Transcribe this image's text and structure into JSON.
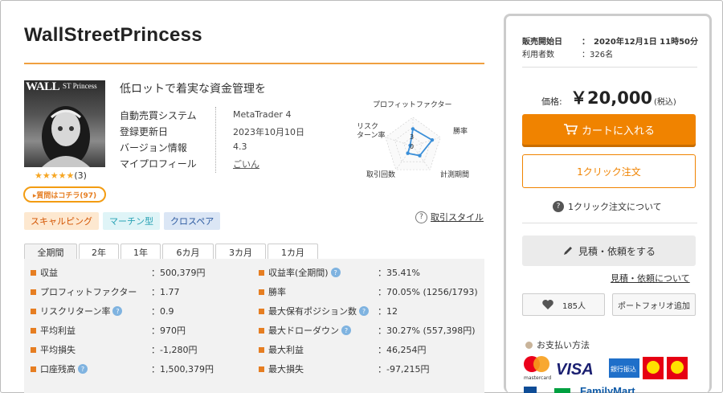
{
  "product": {
    "title": "WallStreetPrincess",
    "tagline": "低ロットで着実な資金管理を",
    "image_logo": "WALL",
    "image_logo_sub": "ST Princess",
    "stars": "★★★★★",
    "review_count": "(3)",
    "question_badge": "▸質問はコチラ(97)",
    "specs": [
      {
        "label": "自動売買システム",
        "value": "MetaTrader 4"
      },
      {
        "label": "登録更新日",
        "value": "2023年10月10日"
      },
      {
        "label": "バージョン情報",
        "value": "4.3"
      },
      {
        "label": "マイプロフィール",
        "value": "ごいん"
      }
    ],
    "tags": [
      "スキャルピング",
      "マーチン型",
      "クロスペア"
    ],
    "help_link": "取引スタイル"
  },
  "radar": {
    "axes": [
      "プロフィットファクター",
      "勝率",
      "計測期間",
      "取引回数",
      "リスク\nターン率"
    ],
    "axis_label_lines": [
      [
        "プロフィットファクター"
      ],
      [
        "勝率"
      ],
      [
        "計測期間"
      ],
      [
        "取引回数"
      ],
      [
        "リスク",
        "ターン率"
      ]
    ],
    "scale_labels": [
      "3",
      "0"
    ],
    "values": [
      3,
      3.5,
      2,
      1.5,
      0.5
    ],
    "max": 5,
    "color": "#3a8fd9"
  },
  "period_tabs": [
    "全期間",
    "2年",
    "1年",
    "6カ月",
    "3カ月",
    "1カ月"
  ],
  "stats_left": [
    {
      "label": "収益",
      "value": "：500,379円",
      "help": false
    },
    {
      "label": "プロフィットファクター",
      "value": "：1.77",
      "help": false
    },
    {
      "label": "リスクリターン率",
      "value": "：0.9",
      "help": true
    },
    {
      "label": "平均利益",
      "value": "：970円",
      "help": false
    },
    {
      "label": "平均損失",
      "value": "：-1,280円",
      "help": false
    },
    {
      "label": "口座残高",
      "value": "：1,500,379円",
      "help": true
    }
  ],
  "stats_right": [
    {
      "label": "収益率(全期間)",
      "value": "：35.41%",
      "help": true
    },
    {
      "label": "勝率",
      "value": "：70.05% (1256/1793)",
      "help": false
    },
    {
      "label": "最大保有ポジション数",
      "value": "：12",
      "help": true
    },
    {
      "label": "最大ドローダウン",
      "value": "：30.27% (557,398円)",
      "help": true
    },
    {
      "label": "最大利益",
      "value": "：46,254円",
      "help": false
    },
    {
      "label": "最大損失",
      "value": "：-97,215円",
      "help": false
    }
  ],
  "sidebar": {
    "sale_start_label": "販売開始日",
    "sale_start_value": "：　2020年12月1日 11時50分",
    "users_label": "利用者数",
    "users_value": "：326名",
    "price_label": "価格:",
    "price": "￥20,000",
    "price_tax": "(税込)",
    "cart_button": "カートに入れる",
    "oneclick_button": "1クリック注文",
    "about_oneclick": "1クリック注文について",
    "quote_button": "見積・依頼をする",
    "quote_link": "見積・依頼について",
    "fav_count": "185人",
    "portfolio_button": "ポートフォリオ追加",
    "payment_title": "お支払い方法",
    "pay_visa": "VISA",
    "pay_bank": "銀行振込",
    "pay_mastercard": "mastercard",
    "pay_family": "FamilyMart"
  },
  "colors": {
    "accent": "#f08300",
    "rule": "#f0a040",
    "radar": "#3a8fd9"
  }
}
